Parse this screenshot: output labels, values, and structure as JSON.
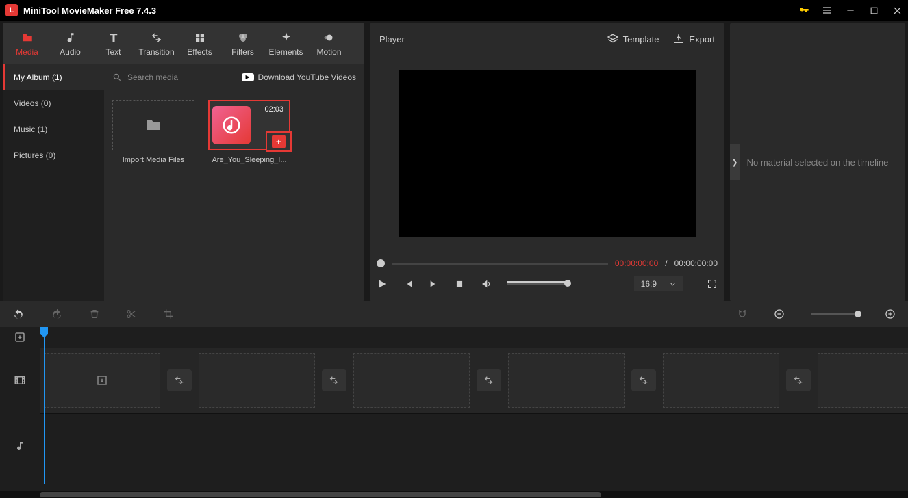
{
  "titlebar": {
    "app_title": "MiniTool MovieMaker Free 7.4.3"
  },
  "tool_tabs": [
    {
      "label": "Media"
    },
    {
      "label": "Audio"
    },
    {
      "label": "Text"
    },
    {
      "label": "Transition"
    },
    {
      "label": "Effects"
    },
    {
      "label": "Filters"
    },
    {
      "label": "Elements"
    },
    {
      "label": "Motion"
    }
  ],
  "sidebar": {
    "items": [
      {
        "label": "My Album (1)"
      },
      {
        "label": "Videos (0)"
      },
      {
        "label": "Music (1)"
      },
      {
        "label": "Pictures (0)"
      }
    ]
  },
  "search": {
    "placeholder": "Search media"
  },
  "yt": {
    "label": "Download YouTube Videos"
  },
  "media": {
    "import_label": "Import Media Files",
    "clip": {
      "duration": "02:03",
      "name": "Are_You_Sleeping_I..."
    }
  },
  "player": {
    "title": "Player",
    "template": "Template",
    "export": "Export",
    "time_current": "00:00:00:00",
    "time_sep": "/",
    "time_total": "00:00:00:00",
    "ratio": "16:9"
  },
  "right": {
    "message": "No material selected on the timeline"
  }
}
